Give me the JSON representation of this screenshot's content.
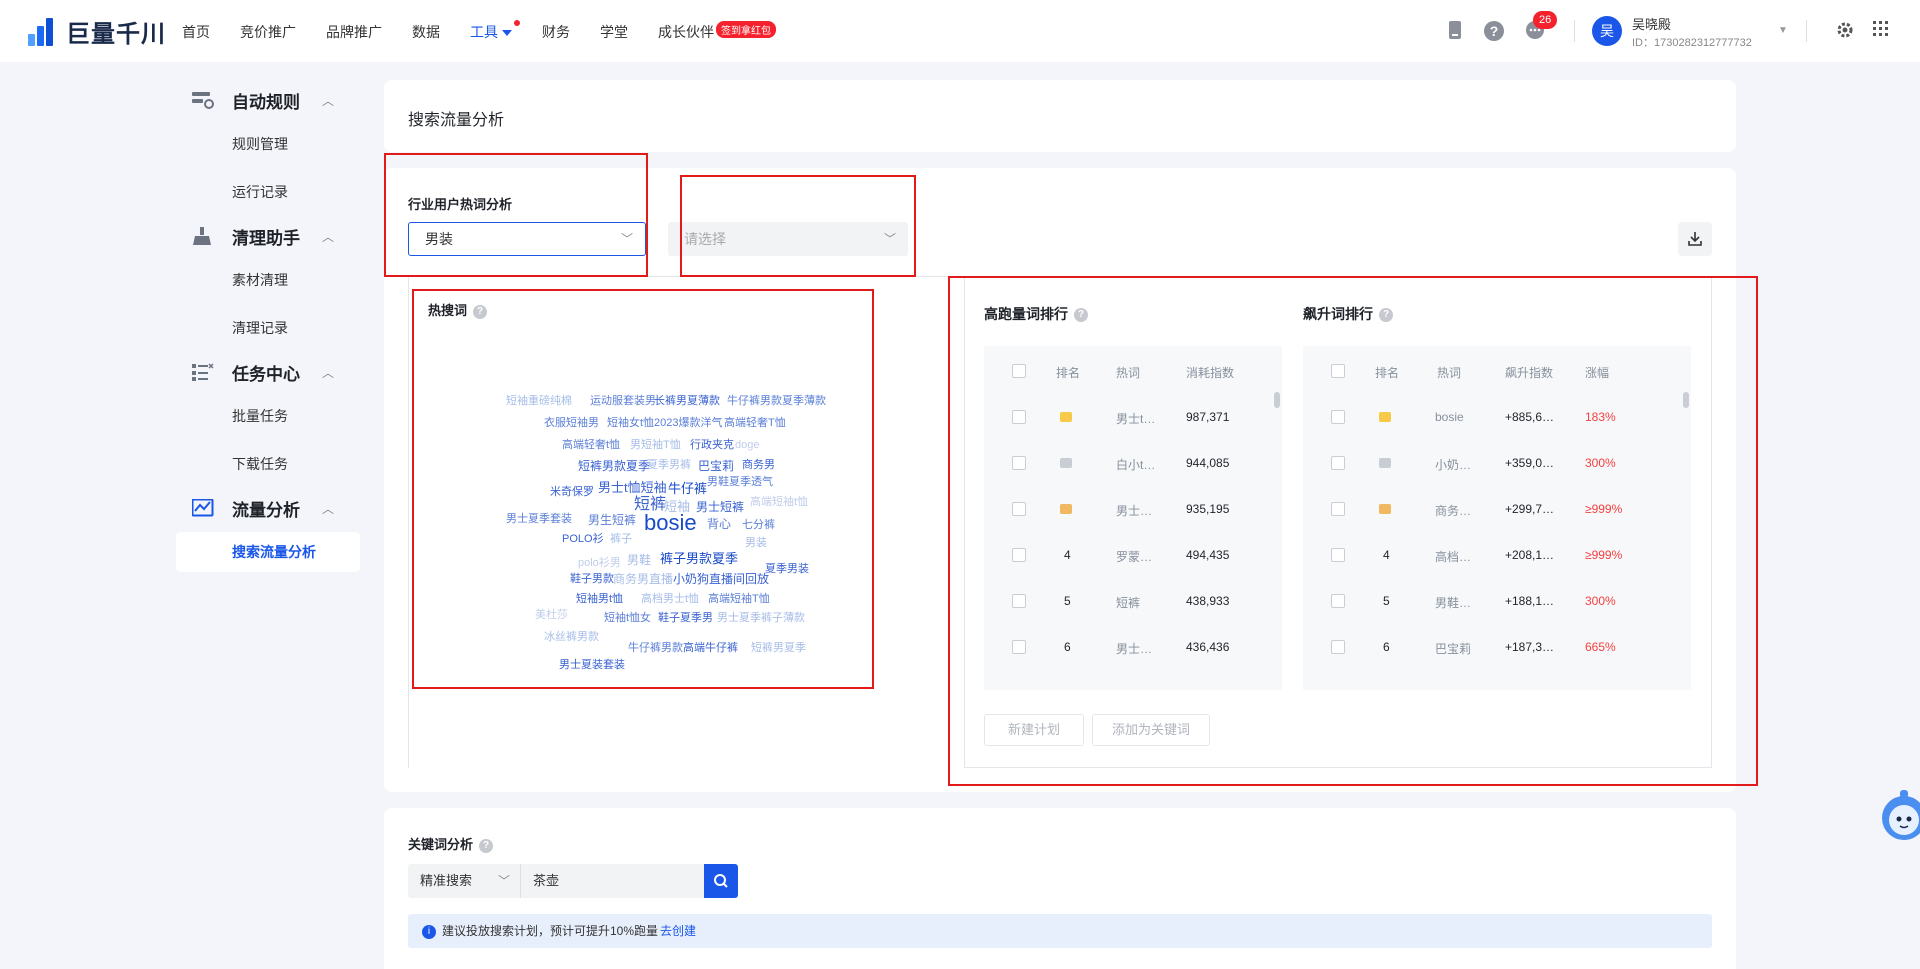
{
  "topbar": {
    "logo_text": "巨量千川",
    "nav": [
      {
        "label": "首页"
      },
      {
        "label": "竞价推广"
      },
      {
        "label": "品牌推广"
      },
      {
        "label": "数据"
      },
      {
        "label": "工具",
        "active": true
      },
      {
        "label": "财务"
      },
      {
        "label": "学堂"
      },
      {
        "label": "成长伙伴",
        "badge": "签到拿红包"
      }
    ],
    "message_count": "26",
    "user": {
      "avatar_char": "吴",
      "name": "吴晓殿",
      "id": "ID：1730282312777732"
    }
  },
  "sidebar": {
    "groups": [
      {
        "label": "自动规则",
        "items": [
          "规则管理",
          "运行记录"
        ]
      },
      {
        "label": "清理助手",
        "items": [
          "素材清理",
          "清理记录"
        ]
      },
      {
        "label": "任务中心",
        "items": [
          "批量任务",
          "下载任务"
        ]
      },
      {
        "label": "流量分析",
        "items": [
          "搜索流量分析"
        ]
      }
    ],
    "active_item": "搜索流量分析"
  },
  "page": {
    "title": "搜索流量分析",
    "industry": {
      "section_title": "行业用户热词分析",
      "select_value": "男装",
      "select2_placeholder": "请选择"
    },
    "hot_search": {
      "title": "热搜词",
      "words": [
        {
          "t": "短袖重磅纯棉",
          "c": "#a7bde8"
        },
        {
          "t": "运动服套装男",
          "c": "#5b7fd6"
        },
        {
          "t": "长裤男夏薄款",
          "c": "#3a63d1"
        },
        {
          "t": "牛仔裤男款夏季薄款",
          "c": "#5b7fd6"
        },
        {
          "t": "衣服短袖男",
          "c": "#5b7fd6"
        },
        {
          "t": "短袖女t恤2023爆款洋气",
          "c": "#5b7fd6"
        },
        {
          "t": "高端轻奢T恤",
          "c": "#5b7fd6"
        },
        {
          "t": "高端轻奢t恤",
          "c": "#5b7fd6"
        },
        {
          "t": "男短袖T恤",
          "c": "#a7bde8"
        },
        {
          "t": "行政夹克",
          "c": "#3a63d1"
        },
        {
          "t": "doge",
          "c": "#c0cdea"
        },
        {
          "t": "短裤男款夏季",
          "c": "#3a63d1"
        },
        {
          "t": "夏季男裤",
          "c": "#a7bde8"
        },
        {
          "t": "巴宝莉",
          "c": "#3a63d1"
        },
        {
          "t": "商务男",
          "c": "#3a63d1"
        },
        {
          "t": "男士t恤短袖",
          "c": "#3a63d1"
        },
        {
          "t": "牛仔裤",
          "c": "#1a4bc9"
        },
        {
          "t": "男鞋夏季透气",
          "c": "#5b7fd6"
        },
        {
          "t": "米奇保罗",
          "c": "#3a63d1"
        },
        {
          "t": "短裤",
          "c": "#3a63d1"
        },
        {
          "t": "短袖",
          "c": "#a7bde8"
        },
        {
          "t": "男士短裤",
          "c": "#3a63d1"
        },
        {
          "t": "高端短袖t恤",
          "c": "#c0cdea"
        },
        {
          "t": "男士夏季套装",
          "c": "#5b7fd6"
        },
        {
          "t": "男生短裤",
          "c": "#5b7fd6"
        },
        {
          "t": "bosie",
          "c": "#1a4bc9"
        },
        {
          "t": "背心",
          "c": "#5b7fd6"
        },
        {
          "t": "七分裤",
          "c": "#5b7fd6"
        },
        {
          "t": "POLO衫",
          "c": "#3a63d1"
        },
        {
          "t": "裤子",
          "c": "#a7bde8"
        },
        {
          "t": "男装",
          "c": "#a7bde8"
        },
        {
          "t": "polo衫男",
          "c": "#c0cdea"
        },
        {
          "t": "男鞋",
          "c": "#a7bde8"
        },
        {
          "t": "裤子男款夏季",
          "c": "#1a4bc9"
        },
        {
          "t": "夏季男装",
          "c": "#3a63d1"
        },
        {
          "t": "鞋子男款",
          "c": "#3a63d1"
        },
        {
          "t": "商务男直播",
          "c": "#a7bde8"
        },
        {
          "t": "小奶狗直播间回放",
          "c": "#3a63d1"
        },
        {
          "t": "短袖男t恤",
          "c": "#3a63d1"
        },
        {
          "t": "高档男士t恤",
          "c": "#a7bde8"
        },
        {
          "t": "高端短袖T恤",
          "c": "#5b7fd6"
        },
        {
          "t": "美杜莎",
          "c": "#c0cdea"
        },
        {
          "t": "短袖t恤女",
          "c": "#5b7fd6"
        },
        {
          "t": "鞋子夏季男",
          "c": "#3a63d1"
        },
        {
          "t": "男士夏季裤子薄款",
          "c": "#a7bde8"
        },
        {
          "t": "冰丝裤男款",
          "c": "#a7bde8"
        },
        {
          "t": "牛仔裤男款",
          "c": "#5b7fd6"
        },
        {
          "t": "高端牛仔裤",
          "c": "#3a63d1"
        },
        {
          "t": "短裤男夏季",
          "c": "#a7bde8"
        },
        {
          "t": "男士夏装套装",
          "c": "#3a63d1"
        }
      ]
    },
    "high_volume": {
      "title": "高跑量词排行",
      "headers": [
        "排名",
        "热词",
        "消耗指数"
      ],
      "rows": [
        {
          "rank": "",
          "word": "男士t…",
          "value": "987,371",
          "crown": "gold"
        },
        {
          "rank": "",
          "word": "白小t…",
          "value": "944,085",
          "crown": "silver"
        },
        {
          "rank": "",
          "word": "男士…",
          "value": "935,195",
          "crown": "bronze"
        },
        {
          "rank": "4",
          "word": "罗蒙…",
          "value": "494,435"
        },
        {
          "rank": "5",
          "word": "短裤",
          "value": "438,933"
        },
        {
          "rank": "6",
          "word": "男士…",
          "value": "436,436"
        }
      ]
    },
    "rising": {
      "title": "飙升词排行",
      "headers": [
        "排名",
        "热词",
        "飙升指数",
        "涨幅"
      ],
      "rows": [
        {
          "rank": "",
          "word": "bosie",
          "value": "+885,6…",
          "pct": "183%",
          "crown": "gold"
        },
        {
          "rank": "",
          "word": "小奶…",
          "value": "+359,0…",
          "pct": "300%",
          "crown": "silver"
        },
        {
          "rank": "",
          "word": "商务…",
          "value": "+299,7…",
          "pct": "≥999%",
          "crown": "bronze"
        },
        {
          "rank": "4",
          "word": "高档…",
          "value": "+208,1…",
          "pct": "≥999%"
        },
        {
          "rank": "5",
          "word": "男鞋…",
          "value": "+188,1…",
          "pct": "300%"
        },
        {
          "rank": "6",
          "word": "巴宝莉",
          "value": "+187,3…",
          "pct": "665%"
        }
      ]
    },
    "buttons": {
      "new_plan": "新建计划",
      "add_keyword": "添加为关键词"
    },
    "keyword": {
      "title": "关键词分析",
      "mode": "精准搜索",
      "input_value": "茶壶",
      "tip_text": "建议投放搜索计划，预计可提升10%跑量",
      "tip_link": "去创建"
    }
  },
  "colors": {
    "accent": "#1a56e8",
    "highlight_box": "#e21a1a"
  }
}
